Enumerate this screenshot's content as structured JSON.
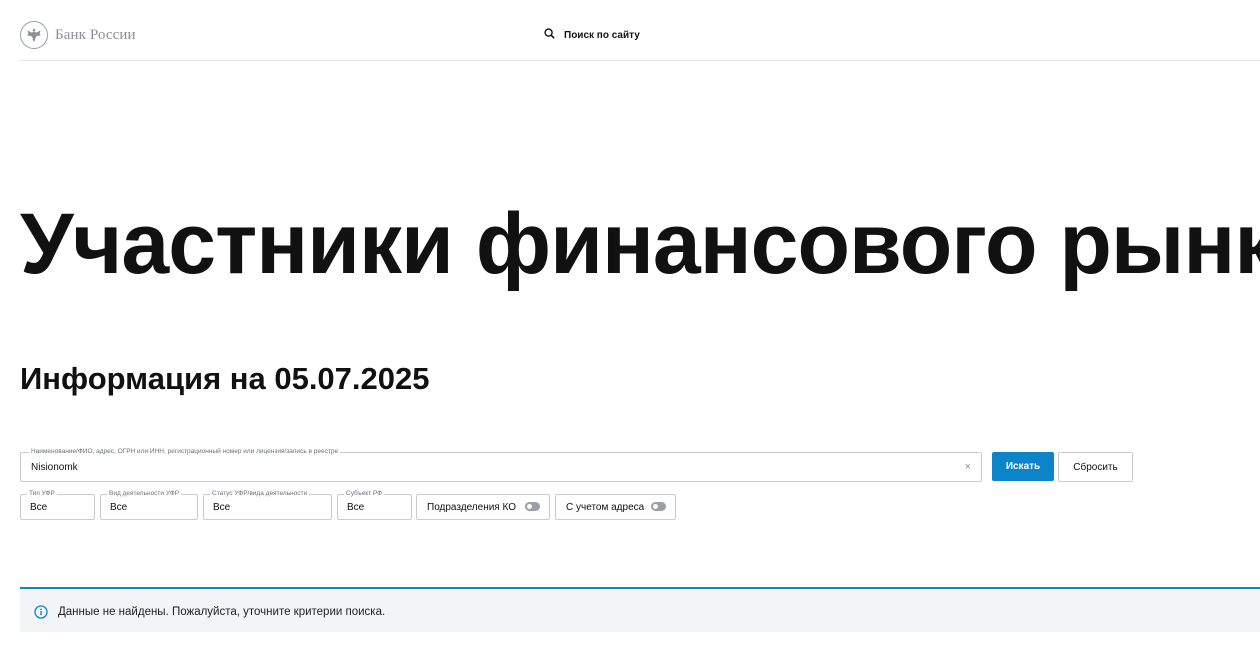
{
  "header": {
    "logo_text": "Банк России",
    "search_label": "Поиск по сайту"
  },
  "page": {
    "title": "Участники финансового рынка",
    "info_title": "Информация на 05.07.2025"
  },
  "search_form": {
    "main_label": "Наименование/ФИО, адрес, ОГРН или ИНН, регистрационный номер или лицензия/запись в реестре",
    "main_value": "Nisionomk",
    "clear_symbol": "×",
    "search_button": "Искать",
    "reset_button": "Сбросить"
  },
  "filters": {
    "ufr_type": {
      "label": "Тип УФР",
      "value": "Все"
    },
    "activity_type": {
      "label": "Вид деятельности УФР",
      "value": "Все"
    },
    "status": {
      "label": "Статус УФР/вида деятельности",
      "value": "Все"
    },
    "region": {
      "label": "Субъект РФ",
      "value": "Все"
    },
    "ko_divisions": {
      "label": "Подразделения КО",
      "checked": false
    },
    "with_address": {
      "label": "С учетом адреса",
      "checked": false
    }
  },
  "notice": {
    "icon": "info-icon",
    "text": "Данные не найдены. Пожалуйста, уточните критерии поиска."
  },
  "colors": {
    "accent": "#0b84c9",
    "notice_bg": "#f3f4f5",
    "border": "#c9ccd1"
  }
}
